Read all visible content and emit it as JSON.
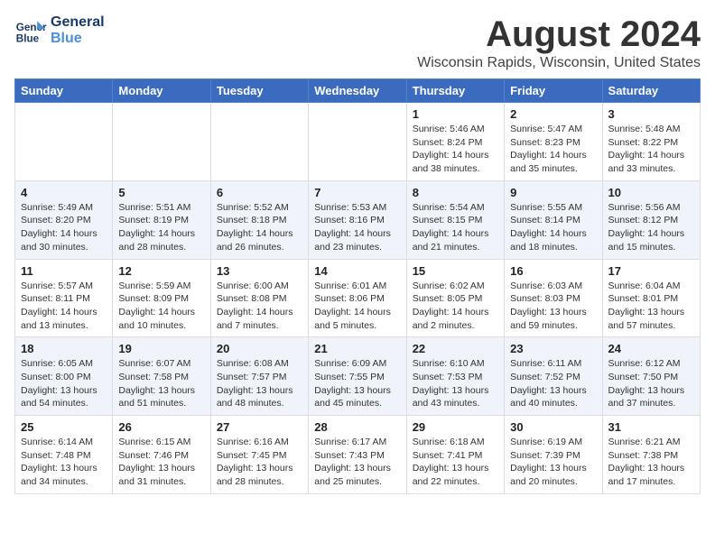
{
  "header": {
    "logo_line1": "General",
    "logo_line2": "Blue",
    "title": "August 2024",
    "subtitle": "Wisconsin Rapids, Wisconsin, United States"
  },
  "columns": [
    "Sunday",
    "Monday",
    "Tuesday",
    "Wednesday",
    "Thursday",
    "Friday",
    "Saturday"
  ],
  "weeks": [
    [
      {
        "day": "",
        "info": ""
      },
      {
        "day": "",
        "info": ""
      },
      {
        "day": "",
        "info": ""
      },
      {
        "day": "",
        "info": ""
      },
      {
        "day": "1",
        "info": "Sunrise: 5:46 AM\nSunset: 8:24 PM\nDaylight: 14 hours\nand 38 minutes."
      },
      {
        "day": "2",
        "info": "Sunrise: 5:47 AM\nSunset: 8:23 PM\nDaylight: 14 hours\nand 35 minutes."
      },
      {
        "day": "3",
        "info": "Sunrise: 5:48 AM\nSunset: 8:22 PM\nDaylight: 14 hours\nand 33 minutes."
      }
    ],
    [
      {
        "day": "4",
        "info": "Sunrise: 5:49 AM\nSunset: 8:20 PM\nDaylight: 14 hours\nand 30 minutes."
      },
      {
        "day": "5",
        "info": "Sunrise: 5:51 AM\nSunset: 8:19 PM\nDaylight: 14 hours\nand 28 minutes."
      },
      {
        "day": "6",
        "info": "Sunrise: 5:52 AM\nSunset: 8:18 PM\nDaylight: 14 hours\nand 26 minutes."
      },
      {
        "day": "7",
        "info": "Sunrise: 5:53 AM\nSunset: 8:16 PM\nDaylight: 14 hours\nand 23 minutes."
      },
      {
        "day": "8",
        "info": "Sunrise: 5:54 AM\nSunset: 8:15 PM\nDaylight: 14 hours\nand 21 minutes."
      },
      {
        "day": "9",
        "info": "Sunrise: 5:55 AM\nSunset: 8:14 PM\nDaylight: 14 hours\nand 18 minutes."
      },
      {
        "day": "10",
        "info": "Sunrise: 5:56 AM\nSunset: 8:12 PM\nDaylight: 14 hours\nand 15 minutes."
      }
    ],
    [
      {
        "day": "11",
        "info": "Sunrise: 5:57 AM\nSunset: 8:11 PM\nDaylight: 14 hours\nand 13 minutes."
      },
      {
        "day": "12",
        "info": "Sunrise: 5:59 AM\nSunset: 8:09 PM\nDaylight: 14 hours\nand 10 minutes."
      },
      {
        "day": "13",
        "info": "Sunrise: 6:00 AM\nSunset: 8:08 PM\nDaylight: 14 hours\nand 7 minutes."
      },
      {
        "day": "14",
        "info": "Sunrise: 6:01 AM\nSunset: 8:06 PM\nDaylight: 14 hours\nand 5 minutes."
      },
      {
        "day": "15",
        "info": "Sunrise: 6:02 AM\nSunset: 8:05 PM\nDaylight: 14 hours\nand 2 minutes."
      },
      {
        "day": "16",
        "info": "Sunrise: 6:03 AM\nSunset: 8:03 PM\nDaylight: 13 hours\nand 59 minutes."
      },
      {
        "day": "17",
        "info": "Sunrise: 6:04 AM\nSunset: 8:01 PM\nDaylight: 13 hours\nand 57 minutes."
      }
    ],
    [
      {
        "day": "18",
        "info": "Sunrise: 6:05 AM\nSunset: 8:00 PM\nDaylight: 13 hours\nand 54 minutes."
      },
      {
        "day": "19",
        "info": "Sunrise: 6:07 AM\nSunset: 7:58 PM\nDaylight: 13 hours\nand 51 minutes."
      },
      {
        "day": "20",
        "info": "Sunrise: 6:08 AM\nSunset: 7:57 PM\nDaylight: 13 hours\nand 48 minutes."
      },
      {
        "day": "21",
        "info": "Sunrise: 6:09 AM\nSunset: 7:55 PM\nDaylight: 13 hours\nand 45 minutes."
      },
      {
        "day": "22",
        "info": "Sunrise: 6:10 AM\nSunset: 7:53 PM\nDaylight: 13 hours\nand 43 minutes."
      },
      {
        "day": "23",
        "info": "Sunrise: 6:11 AM\nSunset: 7:52 PM\nDaylight: 13 hours\nand 40 minutes."
      },
      {
        "day": "24",
        "info": "Sunrise: 6:12 AM\nSunset: 7:50 PM\nDaylight: 13 hours\nand 37 minutes."
      }
    ],
    [
      {
        "day": "25",
        "info": "Sunrise: 6:14 AM\nSunset: 7:48 PM\nDaylight: 13 hours\nand 34 minutes."
      },
      {
        "day": "26",
        "info": "Sunrise: 6:15 AM\nSunset: 7:46 PM\nDaylight: 13 hours\nand 31 minutes."
      },
      {
        "day": "27",
        "info": "Sunrise: 6:16 AM\nSunset: 7:45 PM\nDaylight: 13 hours\nand 28 minutes."
      },
      {
        "day": "28",
        "info": "Sunrise: 6:17 AM\nSunset: 7:43 PM\nDaylight: 13 hours\nand 25 minutes."
      },
      {
        "day": "29",
        "info": "Sunrise: 6:18 AM\nSunset: 7:41 PM\nDaylight: 13 hours\nand 22 minutes."
      },
      {
        "day": "30",
        "info": "Sunrise: 6:19 AM\nSunset: 7:39 PM\nDaylight: 13 hours\nand 20 minutes."
      },
      {
        "day": "31",
        "info": "Sunrise: 6:21 AM\nSunset: 7:38 PM\nDaylight: 13 hours\nand 17 minutes."
      }
    ]
  ]
}
